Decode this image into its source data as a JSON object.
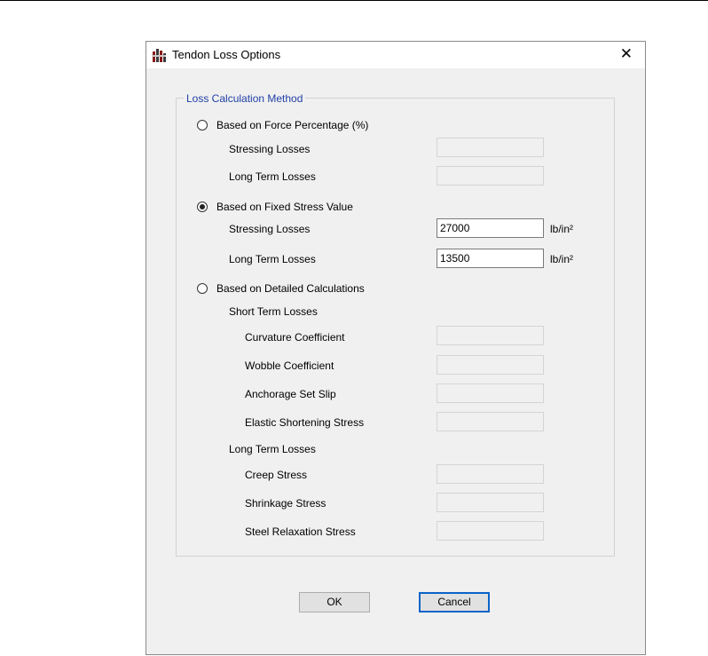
{
  "window": {
    "title": "Tendon Loss Options",
    "close_symbol": "✕",
    "app_icon": "structure-app-icon"
  },
  "group": {
    "legend": "Loss Calculation Method"
  },
  "methods": {
    "force_percentage": {
      "label": "Based on Force Percentage (%)",
      "selected": false,
      "stressing_losses_label": "Stressing Losses",
      "stressing_losses_value": "",
      "long_term_losses_label": "Long Term Losses",
      "long_term_losses_value": ""
    },
    "fixed_stress": {
      "label": "Based on Fixed Stress Value",
      "selected": true,
      "stressing_losses_label": "Stressing Losses",
      "stressing_losses_value": "27000",
      "stressing_losses_unit": "lb/in²",
      "long_term_losses_label": "Long Term Losses",
      "long_term_losses_value": "13500",
      "long_term_losses_unit": "lb/in²"
    },
    "detailed": {
      "label": "Based on Detailed Calculations",
      "selected": false,
      "short_term_heading": "Short Term Losses",
      "curvature_label": "Curvature Coefficient",
      "curvature_value": "",
      "wobble_label": "Wobble Coefficient",
      "wobble_value": "",
      "anchorage_label": "Anchorage Set Slip",
      "anchorage_value": "",
      "elastic_label": "Elastic Shortening Stress",
      "elastic_value": "",
      "long_term_heading": "Long Term Losses",
      "creep_label": "Creep Stress",
      "creep_value": "",
      "shrinkage_label": "Shrinkage Stress",
      "shrinkage_value": "",
      "relaxation_label": "Steel Relaxation Stress",
      "relaxation_value": ""
    }
  },
  "buttons": {
    "ok": "OK",
    "cancel": "Cancel"
  },
  "colors": {
    "legend_text": "#1f3fa6",
    "default_button_border": "#0a64c8",
    "dialog_background": "#f0f0f0"
  }
}
